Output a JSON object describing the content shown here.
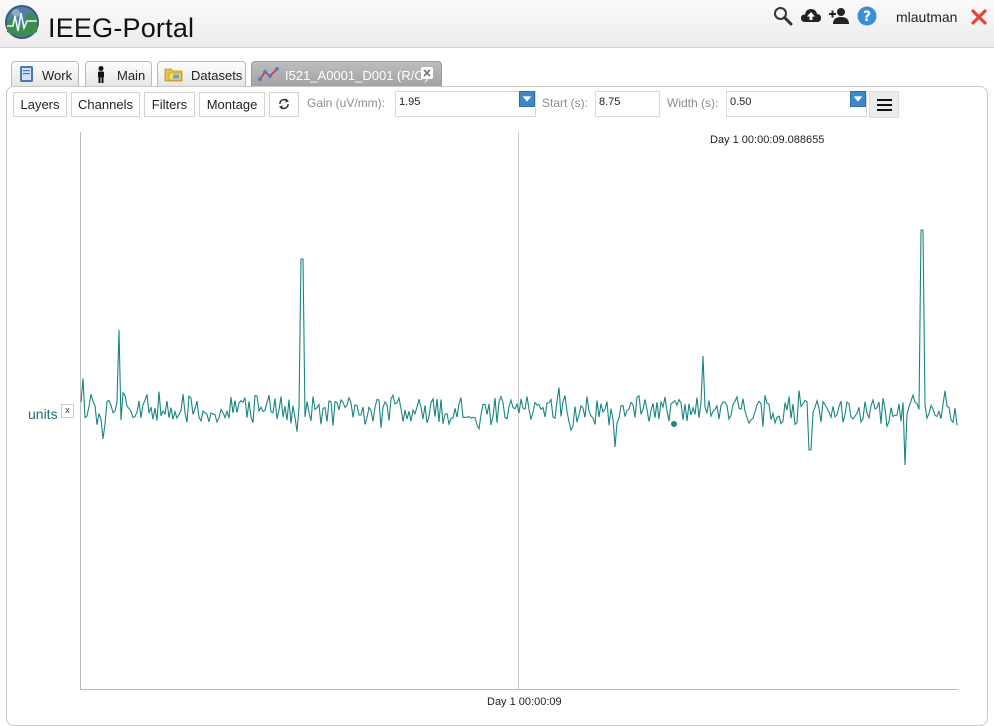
{
  "header": {
    "app_title": "IEEG-Portal",
    "username": "mlautman",
    "icons": [
      "search-icon",
      "cloud-upload-icon",
      "add-user-icon",
      "help-icon",
      "close-icon"
    ]
  },
  "tabs": [
    {
      "label": "Work",
      "icon": "book-icon",
      "active": false
    },
    {
      "label": "Main",
      "icon": "person-icon",
      "active": false
    },
    {
      "label": "Datasets",
      "icon": "folder-icon",
      "active": false
    },
    {
      "label": "I521_A0001_D001 (R/O)",
      "icon": "graph-icon",
      "active": true
    }
  ],
  "toolbar": {
    "layers": "Layers",
    "channels": "Channels",
    "filters": "Filters",
    "montage": "Montage",
    "gain_label": "Gain (uV/mm):",
    "gain_value": "1.95",
    "start_label": "Start (s):",
    "start_value": "8.75",
    "width_label": "Width (s):",
    "width_value": "0.50"
  },
  "viewer": {
    "cursor_timestamp": "Day 1 00:00:09.088655",
    "axis_timestamp": "Day 1 00:00:09",
    "channel_label": "units",
    "channel_close": "x",
    "trace_color": "#1a8580"
  }
}
